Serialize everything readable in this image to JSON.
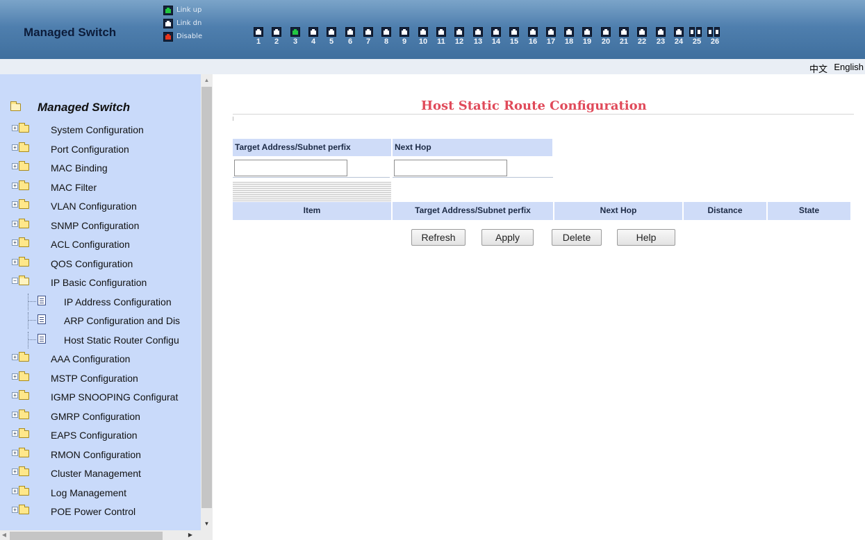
{
  "header": {
    "brand": "Managed Switch",
    "legend": [
      {
        "state": "up",
        "label": "Link up"
      },
      {
        "state": "dn",
        "label": "Link dn"
      },
      {
        "state": "dis",
        "label": "Disable"
      }
    ],
    "ports": [
      {
        "num": "1",
        "state": "dn",
        "kind": "copper"
      },
      {
        "num": "2",
        "state": "dn",
        "kind": "copper"
      },
      {
        "num": "3",
        "state": "up",
        "kind": "copper"
      },
      {
        "num": "4",
        "state": "dn",
        "kind": "copper"
      },
      {
        "num": "5",
        "state": "dn",
        "kind": "copper"
      },
      {
        "num": "6",
        "state": "dn",
        "kind": "copper"
      },
      {
        "num": "7",
        "state": "dn",
        "kind": "copper"
      },
      {
        "num": "8",
        "state": "dn",
        "kind": "copper"
      },
      {
        "num": "9",
        "state": "dn",
        "kind": "copper"
      },
      {
        "num": "10",
        "state": "dn",
        "kind": "copper"
      },
      {
        "num": "11",
        "state": "dn",
        "kind": "copper"
      },
      {
        "num": "12",
        "state": "dn",
        "kind": "copper"
      },
      {
        "num": "13",
        "state": "dn",
        "kind": "copper"
      },
      {
        "num": "14",
        "state": "dn",
        "kind": "copper"
      },
      {
        "num": "15",
        "state": "dn",
        "kind": "copper"
      },
      {
        "num": "16",
        "state": "dn",
        "kind": "copper"
      },
      {
        "num": "17",
        "state": "dn",
        "kind": "copper"
      },
      {
        "num": "18",
        "state": "dn",
        "kind": "copper"
      },
      {
        "num": "19",
        "state": "dn",
        "kind": "copper"
      },
      {
        "num": "20",
        "state": "dn",
        "kind": "copper"
      },
      {
        "num": "21",
        "state": "dn",
        "kind": "copper"
      },
      {
        "num": "22",
        "state": "dn",
        "kind": "copper"
      },
      {
        "num": "23",
        "state": "dn",
        "kind": "copper"
      },
      {
        "num": "24",
        "state": "dn",
        "kind": "copper"
      },
      {
        "num": "25",
        "state": "dn",
        "kind": "fiber"
      },
      {
        "num": "26",
        "state": "dn",
        "kind": "fiber"
      }
    ]
  },
  "lang": {
    "cn": "中文",
    "en": "English"
  },
  "sidebar": {
    "title": "Managed Switch",
    "items": [
      {
        "label": "System Configuration",
        "level": "top",
        "expander": "+"
      },
      {
        "label": "Port Configuration",
        "level": "top",
        "expander": "+"
      },
      {
        "label": "MAC Binding",
        "level": "top",
        "expander": "+"
      },
      {
        "label": "MAC Filter",
        "level": "top",
        "expander": "+"
      },
      {
        "label": "VLAN Configuration",
        "level": "top",
        "expander": "+"
      },
      {
        "label": "SNMP Configuration",
        "level": "top",
        "expander": "+"
      },
      {
        "label": "ACL Configuration",
        "level": "top",
        "expander": "+"
      },
      {
        "label": "QOS Configuration",
        "level": "top",
        "expander": "+"
      },
      {
        "label": "IP Basic Configuration",
        "level": "top",
        "expander": "−",
        "open": true
      },
      {
        "label": "IP Address Configuration",
        "level": "child"
      },
      {
        "label": "ARP Configuration and Dis",
        "level": "child"
      },
      {
        "label": "Host Static Router Configu",
        "level": "child"
      },
      {
        "label": "AAA Configuration",
        "level": "top",
        "expander": "+"
      },
      {
        "label": "MSTP Configuration",
        "level": "top",
        "expander": "+"
      },
      {
        "label": "IGMP SNOOPING Configurat",
        "level": "top",
        "expander": "+"
      },
      {
        "label": "GMRP Configuration",
        "level": "top",
        "expander": "+"
      },
      {
        "label": "EAPS Configuration",
        "level": "top",
        "expander": "+"
      },
      {
        "label": "RMON Configuration",
        "level": "top",
        "expander": "+"
      },
      {
        "label": "Cluster Management",
        "level": "top",
        "expander": "+"
      },
      {
        "label": "Log Management",
        "level": "top",
        "expander": "+"
      },
      {
        "label": "POE Power Control",
        "level": "top",
        "expander": "+"
      }
    ]
  },
  "main": {
    "title": "Host Static Route Configuration",
    "form": {
      "target_header": "Target Address/Subnet perfix",
      "nexthop_header": "Next Hop",
      "target_value": "",
      "nexthop_value": ""
    },
    "table": {
      "columns": [
        "Item",
        "Target Address/Subnet perfix",
        "Next Hop",
        "Distance",
        "State"
      ],
      "rows": []
    },
    "buttons": {
      "refresh": "Refresh",
      "apply": "Apply",
      "delete": "Delete",
      "help": "Help"
    }
  },
  "colors": {
    "header_top": "#7ba4c9",
    "header_bottom": "#3f6f9e",
    "sidebar_bg": "#c9dafa",
    "title_red": "#e04a5a",
    "table_header_bg": "#cfdcf8",
    "link_up": "#22c742",
    "disable": "#e8351c"
  }
}
